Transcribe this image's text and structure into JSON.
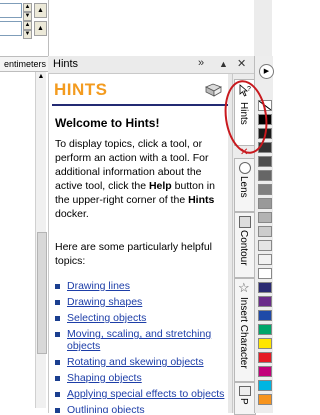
{
  "ruler_unit": "entimeters",
  "docker": {
    "title": "Hints",
    "heading": "HINTS",
    "welcome": "Welcome to Hints!",
    "intro_1": "To display topics, click a tool, or perform an action with a tool. For additional information about the active tool, click the ",
    "intro_help": "Help",
    "intro_2": " button in the upper-right corner of the ",
    "intro_hints": "Hints",
    "intro_3": " docker.",
    "topics_intro": "Here are some particularly helpful topics:",
    "topics": [
      "Drawing lines",
      "Drawing shapes",
      "Selecting objects",
      "Moving, scaling, and stretching objects",
      "Rotating and skewing objects",
      "Shaping objects",
      "Applying special effects to objects",
      "Outlining objects"
    ]
  },
  "tabs": [
    "Hints",
    "Lens",
    "Contour",
    "Insert Character",
    "P"
  ],
  "colors": {
    "hints_orange": "#f39b1f",
    "rule_navy": "#232a73",
    "link_blue": "#1d3ea8",
    "highlight_red": "#c8191e"
  }
}
